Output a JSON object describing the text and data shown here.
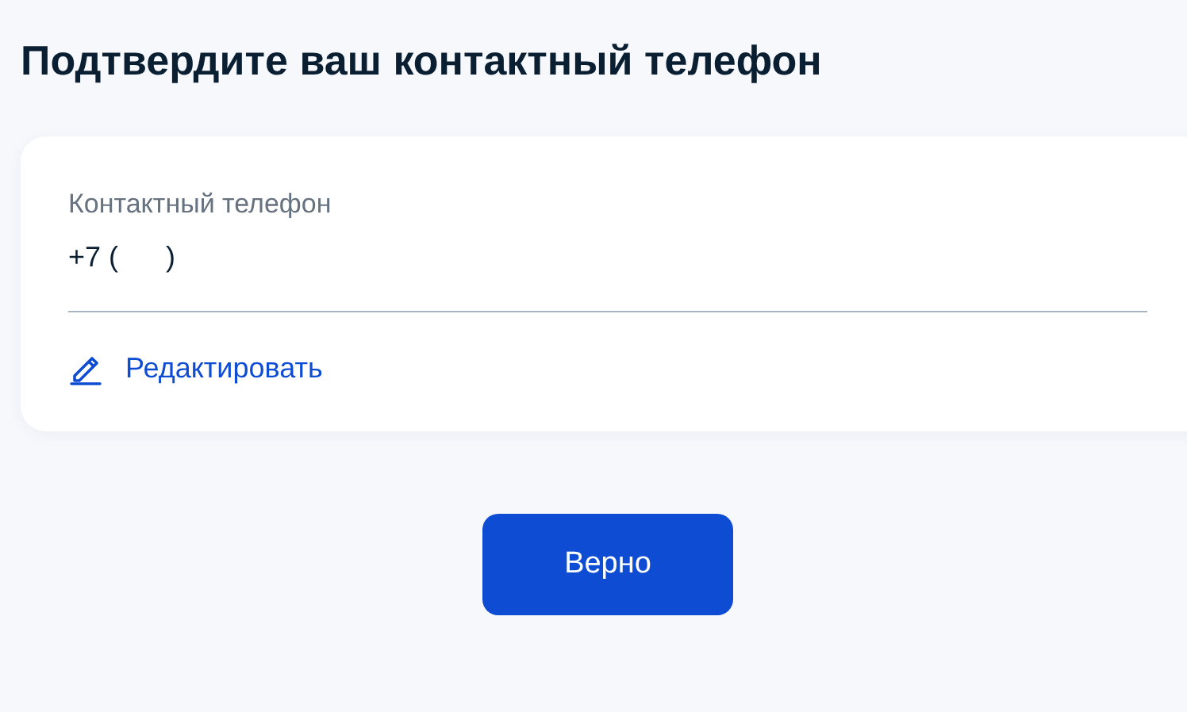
{
  "title": "Подтвердите ваш контактный телефон",
  "field": {
    "label": "Контактный телефон",
    "value": "+7 (      )"
  },
  "edit_link": "Редактировать",
  "confirm_button": "Верно"
}
